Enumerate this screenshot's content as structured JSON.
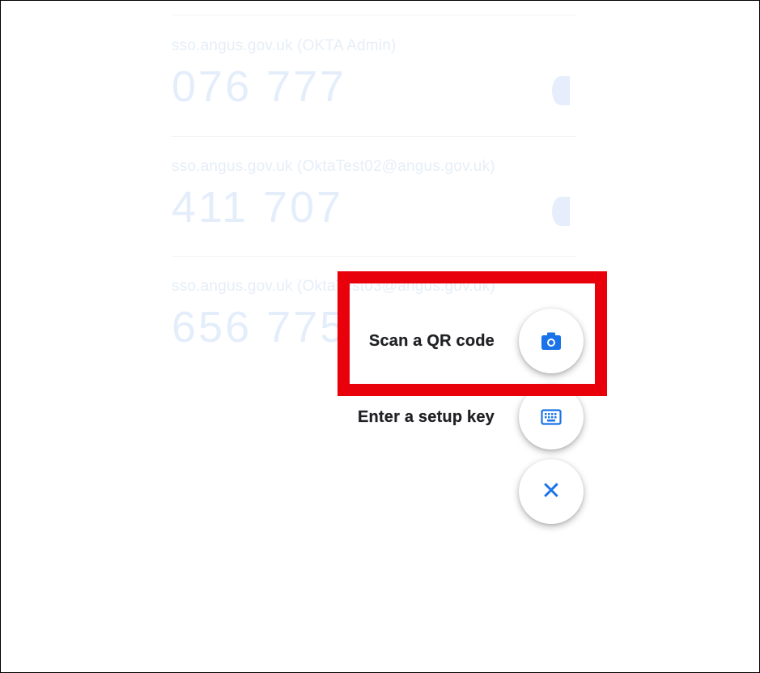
{
  "accounts": [
    {
      "label": "sso.angus.gov.uk (OKTA Admin)",
      "code": "076 777"
    },
    {
      "label": "sso.angus.gov.uk (OktaTest02@angus.gov.uk)",
      "code": "411 707"
    },
    {
      "label": "sso.angus.gov.uk (OktaTest03@angus.gov.uk)",
      "code": "656 775"
    }
  ],
  "menu": {
    "scan_label": "Scan a QR code",
    "setup_label": "Enter a setup key",
    "close_glyph": "✕"
  },
  "icons": {
    "scan": "camera-icon",
    "setup": "keyboard-icon",
    "close": "close-icon"
  },
  "colors": {
    "accent": "#1a73e8",
    "highlight_border": "#e8000a",
    "faded_text": "#e4eefb"
  }
}
